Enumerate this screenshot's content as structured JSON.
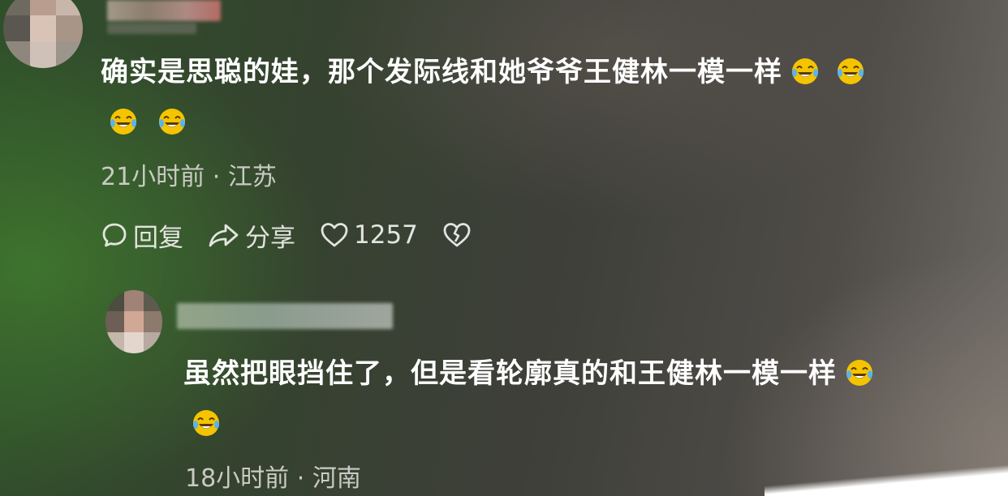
{
  "comments": [
    {
      "text_line1": "确实是思聪的娃，那个发际线和她爷爷王健林一模一样",
      "emoji_icon": "laugh-cry-emoji",
      "time": "21小时前",
      "separator": "·",
      "location": "江苏",
      "actions": {
        "reply_label": "回复",
        "share_label": "分享",
        "like_count": "1257"
      }
    },
    {
      "text_line1": "虽然把眼挡住了，但是看轮廓真的和王健林一模一样",
      "emoji_icon": "laugh-cry-emoji",
      "time": "18小时前",
      "separator": "·",
      "location": "河南"
    }
  ],
  "colors": {
    "emoji_yellow": "#f5c400",
    "emoji_tear": "#5bb2ee",
    "meta_text": "#c9cbc4"
  }
}
